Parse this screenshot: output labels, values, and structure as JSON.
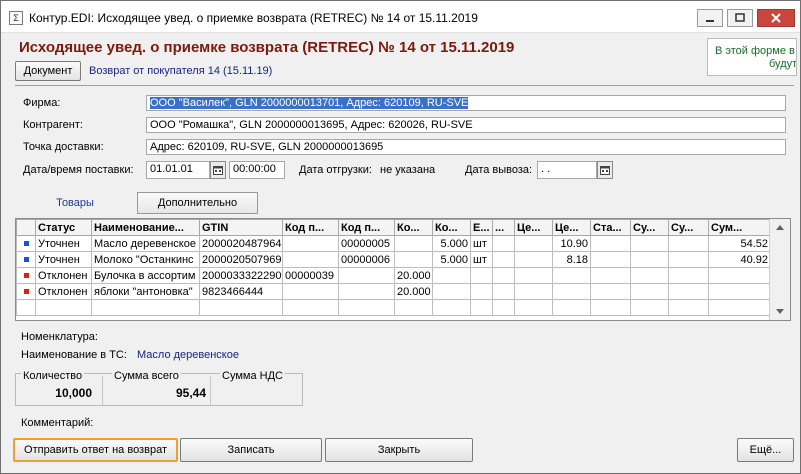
{
  "window": {
    "title": "Контур.EDI: Исходящее увед. о приемке возврата (RETREC) № 14 от 15.11.2019",
    "icon_label": "Σ"
  },
  "header": {
    "doc_title": "Исходящее увед. о приемке возврата (RETREC) № 14 от 15.11.2019",
    "document_button": "Документ",
    "return_link": "Возврат от покупателя 14 (15.11.19)",
    "side_notice_line1": "В этой форме в",
    "side_notice_line2": "будут"
  },
  "fields": {
    "firm_label": "Фирма:",
    "firm_value": "ООО \"Василек\", GLN 2000000013701, Адрес: 620109, RU-SVE",
    "counterparty_label": "Контрагент:",
    "counterparty_value": "ООО \"Ромашка\", GLN 2000000013695, Адрес: 620026, RU-SVE",
    "delivery_point_label": "Точка доставки:",
    "delivery_point_value": "Адрес: 620109, RU-SVE, GLN 2000000013695",
    "delivery_datetime_label": "Дата/время поставки:",
    "delivery_date": "01.01.01",
    "delivery_time": "00:00:00",
    "shipment_date_label": "Дата отгрузки:",
    "shipment_date_value": "не указана",
    "export_date_label": "Дата вывоза:",
    "export_date_value": " .  .  "
  },
  "tabs": [
    {
      "label": "Товары"
    },
    {
      "label": "Дополнительно"
    }
  ],
  "table": {
    "headers": [
      "",
      "Статус",
      "Наименование...",
      "GTIN",
      "Код п...",
      "Код п...",
      "Ко...",
      "Ко...",
      "Е...",
      "...",
      "Це...",
      "Це...",
      "Ста...",
      "Су...",
      "Су...",
      "Сум..."
    ],
    "rows": [
      {
        "marker_color": "#1f4fd6",
        "cells": [
          "Уточнен",
          "Масло деревенское",
          "2000020487964",
          "",
          "00000005",
          "",
          "5.000",
          "шт",
          "",
          "",
          "10.90",
          "",
          "",
          "",
          "54.52"
        ]
      },
      {
        "marker_color": "#1f4fd6",
        "cells": [
          "Уточнен",
          "Молоко \"Останкинс",
          "2000020507969",
          "",
          "00000006",
          "",
          "5.000",
          "шт",
          "",
          "",
          "8.18",
          "",
          "",
          "",
          "40.92"
        ]
      },
      {
        "marker_color": "#d62020",
        "cells": [
          "Отклонен",
          "Булочка в ассортим",
          "2000033322290",
          "00000039",
          "",
          "20.000",
          "",
          "",
          "",
          "",
          "",
          "",
          "",
          "",
          ""
        ]
      },
      {
        "marker_color": "#d62020",
        "cells": [
          "Отклонен",
          "яблоки \"антоновка\"",
          "9823466444",
          "",
          "",
          "20.000",
          "",
          "",
          "",
          "",
          "",
          "",
          "",
          "",
          ""
        ]
      }
    ]
  },
  "details": {
    "nomenclature_label": "Номенклатура:",
    "name_in_ts_label": "Наименование в ТС:",
    "name_in_ts_value": "Масло деревенское"
  },
  "summary": {
    "quantity_label": "Количество",
    "quantity_value": "10,000",
    "total_label": "Сумма всего",
    "total_value": "95,44",
    "vat_label": "Сумма НДС",
    "vat_value": ""
  },
  "comment_label": "Комментарий:",
  "footer": {
    "send_button": "Отправить ответ на возврат",
    "save_button": "Записать",
    "close_button": "Закрыть",
    "more_button": "Ещё..."
  }
}
